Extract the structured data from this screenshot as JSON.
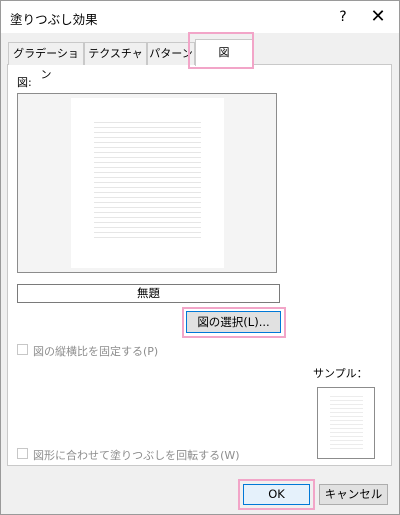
{
  "dialog": {
    "title": "塗りつぶし効果",
    "help_label": "?",
    "close_label": "✕"
  },
  "tabs": [
    {
      "label": "グラデーション",
      "active": false
    },
    {
      "label": "テクスチャ",
      "active": false
    },
    {
      "label": "パターン",
      "active": false
    },
    {
      "label": "図",
      "active": true
    }
  ],
  "picture": {
    "label": "図:",
    "filename": "無題",
    "select_button": "図の選択(L)..."
  },
  "options": {
    "lock_aspect": {
      "label": "図の縦横比を固定する(P)",
      "checked": false,
      "enabled": false
    },
    "rotate_with_shape": {
      "label": "図形に合わせて塗りつぶしを回転する(W)",
      "checked": false,
      "enabled": false
    }
  },
  "sample": {
    "label": "サンプル："
  },
  "footer": {
    "ok_label": "OK",
    "cancel_label": "キャンセル"
  },
  "colors": {
    "highlight": "#f2a5c8",
    "focus_border": "#0078d7"
  }
}
